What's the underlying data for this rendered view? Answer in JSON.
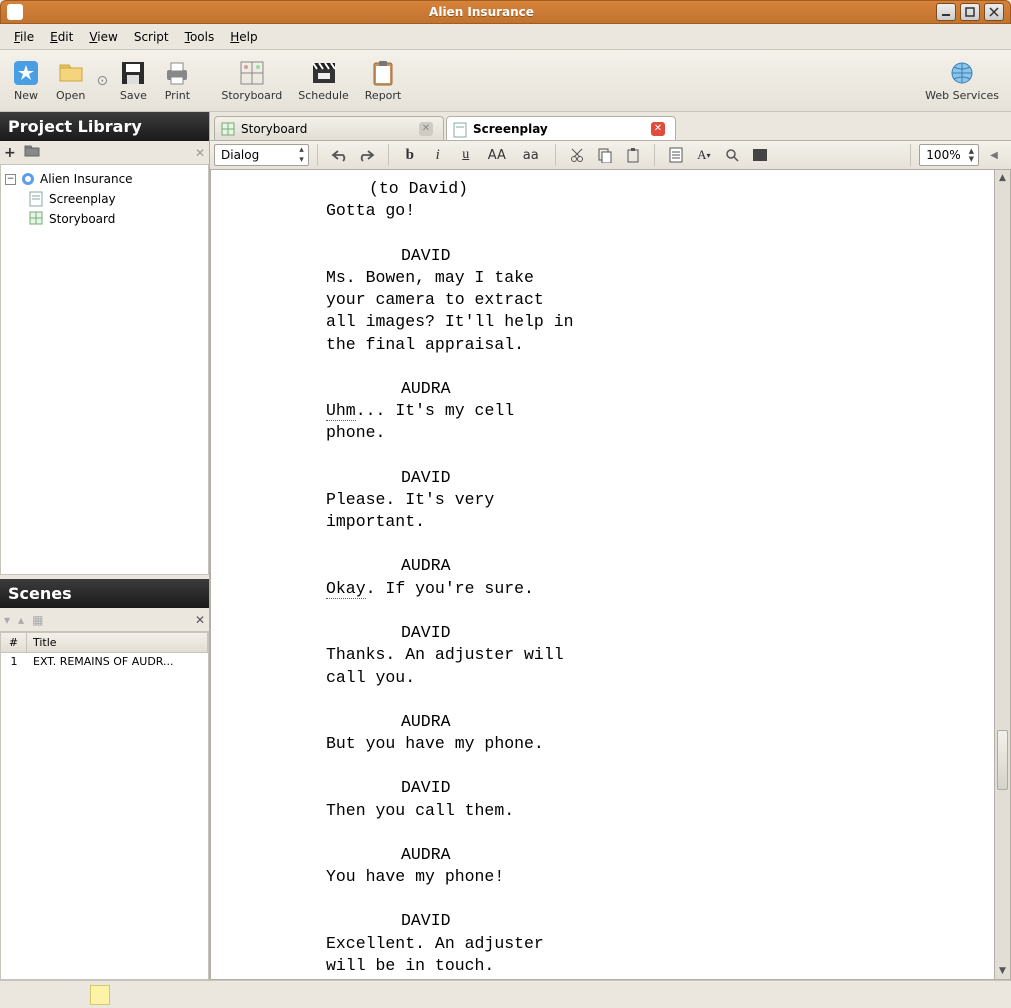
{
  "window": {
    "title": "Alien Insurance"
  },
  "menu": {
    "file": "File",
    "edit": "Edit",
    "view": "View",
    "script": "Script",
    "tools": "Tools",
    "help": "Help"
  },
  "toolbar": {
    "new": "New",
    "open": "Open",
    "save": "Save",
    "print": "Print",
    "storyboard": "Storyboard",
    "schedule": "Schedule",
    "report": "Report",
    "webservices": "Web Services"
  },
  "project_library": {
    "title": "Project Library",
    "root": "Alien Insurance",
    "children": [
      "Screenplay",
      "Storyboard"
    ]
  },
  "scenes": {
    "title": "Scenes",
    "col_num": "#",
    "col_title": "Title",
    "rows": [
      {
        "num": "1",
        "title": "EXT. REMAINS OF AUDR..."
      }
    ]
  },
  "tabs": {
    "storyboard": "Storyboard",
    "screenplay": "Screenplay"
  },
  "editor_toolbar": {
    "style": "Dialog",
    "bold": "b",
    "italic": "i",
    "underline": "u",
    "caps": "AA",
    "lower": "aa",
    "zoom": "100%"
  },
  "screenplay": {
    "b0_paren": "(to David)",
    "b0_dlg": "Gotta go!",
    "b1_char": "DAVID",
    "b1_l1": "Ms. Bowen, may I take",
    "b1_l2": "your camera to extract",
    "b1_l3": "all images? It'll help in",
    "b1_l4": "the final appraisal.",
    "b2_char": "AUDRA",
    "b2_sp": "Uhm",
    "b2_l1_rest": "... It's my cell",
    "b2_l2": "phone.",
    "b3_char": "DAVID",
    "b3_l1": "Please. It's very",
    "b3_l2": "important.",
    "b4_char": "AUDRA",
    "b4_sp": "Okay",
    "b4_l1_rest": ". If you're sure.",
    "b5_char": "DAVID",
    "b5_l1": "Thanks. An adjuster will",
    "b5_l2": "call you.",
    "b6_char": "AUDRA",
    "b6_l1": "But you have my phone.",
    "b7_char": "DAVID",
    "b7_l1": "Then you call them.",
    "b8_char": "AUDRA",
    "b8_l1": "You have my phone!",
    "b9_char": "DAVID",
    "b9_l1": "Excellent. An adjuster",
    "b9_l2": "will be in touch."
  }
}
